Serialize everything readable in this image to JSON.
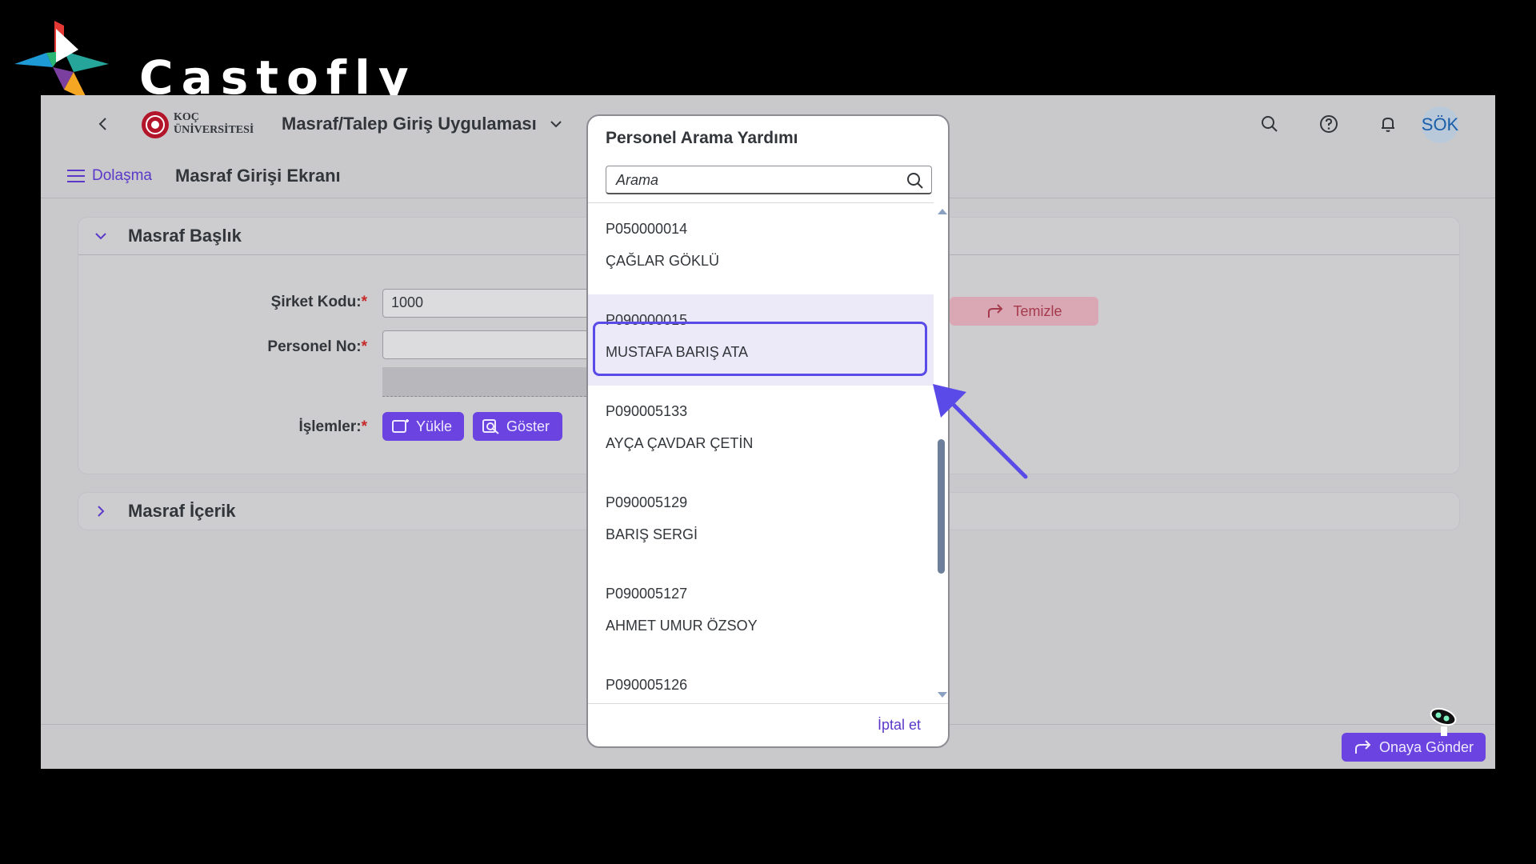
{
  "brand": {
    "name": "Castofly"
  },
  "shell": {
    "logo_line1": "KOÇ",
    "logo_line2": "ÜNİVERSİTESİ",
    "app_title": "Masraf/Talep Giriş Uygulaması",
    "avatar": "SÖK"
  },
  "subbar": {
    "nav_label": "Dolaşma",
    "page_title": "Masraf Girişi Ekranı"
  },
  "header_panel": {
    "title": "Masraf Başlık",
    "company_label": "Şirket Kodu:",
    "company_value": "1000",
    "personnel_label": "Personel No:",
    "personnel_value": "",
    "operations_label": "İşlemler:",
    "required_mark": "*",
    "upload_label": "Yükle",
    "show_label": "Göster",
    "clear_label": "Temizle"
  },
  "content_panel": {
    "title": "Masraf İçerik"
  },
  "footer": {
    "approve_label": "Onaya Gönder"
  },
  "dialog": {
    "title": "Personel Arama Yardımı",
    "search_placeholder": "Arama",
    "cancel_label": "İptal et",
    "items": [
      {
        "id": "P050000014",
        "name": "ÇAĞLAR GÖKLÜ"
      },
      {
        "id": "P090000015",
        "name": "MUSTAFA BARIŞ ATA"
      },
      {
        "id": "P090005133",
        "name": "AYÇA ÇAVDAR ÇETİN"
      },
      {
        "id": "P090005129",
        "name": "BARIŞ SERGİ"
      },
      {
        "id": "P090005127",
        "name": "AHMET UMUR ÖZSOY"
      },
      {
        "id": "P090005126",
        "name": ""
      }
    ],
    "selected_index": 1
  },
  "colors": {
    "accent": "#6a43e0",
    "highlight_border": "#5a4be8",
    "required": "#c62828",
    "clear_button_text": "#a63a4d"
  }
}
